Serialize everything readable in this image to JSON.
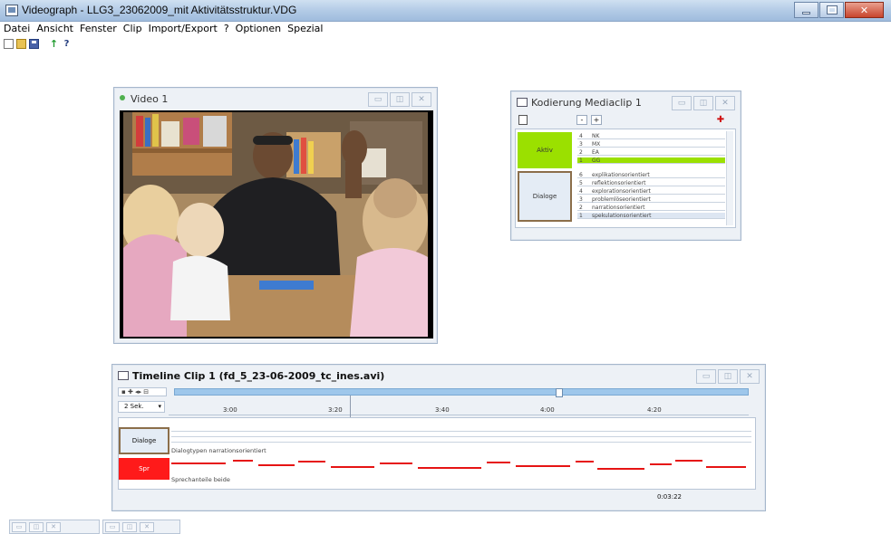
{
  "app": {
    "title": "Videograph - LLG3_23062009_mit Aktivitätsstruktur.VDG",
    "buttons": {
      "minimize": "–",
      "maximize": "□",
      "close": "✕"
    }
  },
  "menu": [
    "Datei",
    "Ansicht",
    "Fenster",
    "Clip",
    "Import/Export",
    "?",
    "Optionen",
    "Spezial"
  ],
  "toolbar": [
    "new-icon",
    "open-icon",
    "save-icon",
    "upload-icon",
    "help-icon"
  ],
  "video_window": {
    "title": "Video 1"
  },
  "coding_window": {
    "title": "Kodierung Mediaclip 1",
    "ctrl_minus": "-",
    "ctrl_plus": "+",
    "categories": [
      {
        "name": "Aktiv",
        "codes": [
          {
            "num": "4",
            "label": "NK"
          },
          {
            "num": "3",
            "label": "MX"
          },
          {
            "num": "2",
            "label": "EA"
          },
          {
            "num": "1",
            "label": "GG"
          }
        ],
        "active_code": "GG"
      },
      {
        "name": "Dialoge",
        "codes": [
          {
            "num": "6",
            "label": "explikationsorientiert"
          },
          {
            "num": "5",
            "label": "reflektionsorientiert"
          },
          {
            "num": "4",
            "label": "explorationsorientiert"
          },
          {
            "num": "3",
            "label": "problemlöseorientiert"
          },
          {
            "num": "2",
            "label": "narrationsorientiert"
          },
          {
            "num": "1",
            "label": "spekulationsorientiert"
          }
        ]
      }
    ]
  },
  "timeline_window": {
    "title": "Timeline Clip 1 (fd_5_23-06-2009_tc_ines.avi)",
    "zoom": "2 Sek.",
    "times": [
      "3:00",
      "3:20",
      "3:40",
      "4:00",
      "4:20"
    ],
    "tracks": [
      {
        "name": "Dialoge",
        "caption": "Dialogtypen narrationsorientiert"
      },
      {
        "name": "Spr",
        "caption": "Sprechanteile beide"
      }
    ],
    "current_time": "0:03:22"
  },
  "colors": {
    "active_green": "#9be000",
    "speech_red": "#ff1a1a",
    "timeline_scroll": "#9ec7eb"
  }
}
